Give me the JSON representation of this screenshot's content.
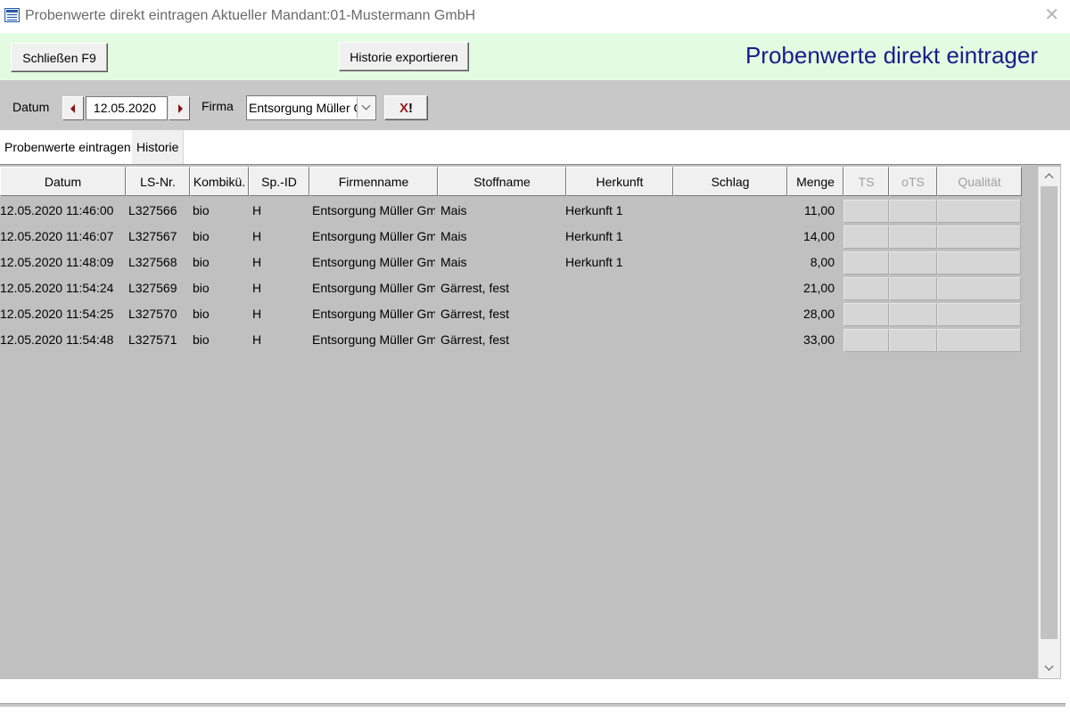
{
  "window": {
    "title": "Probenwerte direkt eintragen Aktueller Mandant:01-Mustermann GmbH",
    "close_icon": "close-icon"
  },
  "header": {
    "close_button": "Schließen F9",
    "export_button": "Historie exportieren",
    "form_title": "Probenwerte direkt eintrager"
  },
  "filter": {
    "datum_label": "Datum",
    "datum_value": "12.05.2020",
    "firma_label": "Firma",
    "firma_value": "Entsorgung Müller GmbH",
    "clear_x": "X",
    "clear_mark": "!"
  },
  "tabs": [
    {
      "label": "Probenwerte eintragen",
      "active": true
    },
    {
      "label": "Historie",
      "active": false
    }
  ],
  "table": {
    "columns": [
      "Datum",
      "LS-Nr.",
      "Kombikü.",
      "Sp.-ID",
      "Firmenname",
      "Stoffname",
      "Herkunft",
      "Schlag",
      "Menge",
      "TS",
      "oTS",
      "Qualität"
    ],
    "disabled_columns": [
      "TS",
      "oTS",
      "Qualität"
    ],
    "rows": [
      {
        "datum": "12.05.2020 11:46:00",
        "ls": "L327566",
        "kombi": "bio",
        "sp": "H",
        "firma": "Entsorgung Müller GmbH",
        "stoff": "Mais",
        "herkunft": "Herkunft 1",
        "schlag": "",
        "menge": "11,00"
      },
      {
        "datum": "12.05.2020 11:46:07",
        "ls": "L327567",
        "kombi": "bio",
        "sp": "H",
        "firma": "Entsorgung Müller GmbH",
        "stoff": "Mais",
        "herkunft": "Herkunft 1",
        "schlag": "",
        "menge": "14,00"
      },
      {
        "datum": "12.05.2020 11:48:09",
        "ls": "L327568",
        "kombi": "bio",
        "sp": "H",
        "firma": "Entsorgung Müller GmbH",
        "stoff": "Mais",
        "herkunft": "Herkunft 1",
        "schlag": "",
        "menge": "8,00"
      },
      {
        "datum": "12.05.2020 11:54:24",
        "ls": "L327569",
        "kombi": "bio",
        "sp": "H",
        "firma": "Entsorgung Müller GmbH",
        "stoff": "Gärrest, fest",
        "herkunft": "",
        "schlag": "",
        "menge": "21,00"
      },
      {
        "datum": "12.05.2020 11:54:25",
        "ls": "L327570",
        "kombi": "bio",
        "sp": "H",
        "firma": "Entsorgung Müller GmbH",
        "stoff": "Gärrest, fest",
        "herkunft": "",
        "schlag": "",
        "menge": "28,00"
      },
      {
        "datum": "12.05.2020 11:54:48",
        "ls": "L327571",
        "kombi": "bio",
        "sp": "H",
        "firma": "Entsorgung Müller GmbH",
        "stoff": "Gärrest, fest",
        "herkunft": "",
        "schlag": "",
        "menge": "33,00"
      }
    ]
  },
  "colors": {
    "header_band": "#e3fbe0",
    "form_title": "#1a1a8c",
    "grid_background": "#c0c0c0",
    "nav_arrow": "#8b1010"
  }
}
